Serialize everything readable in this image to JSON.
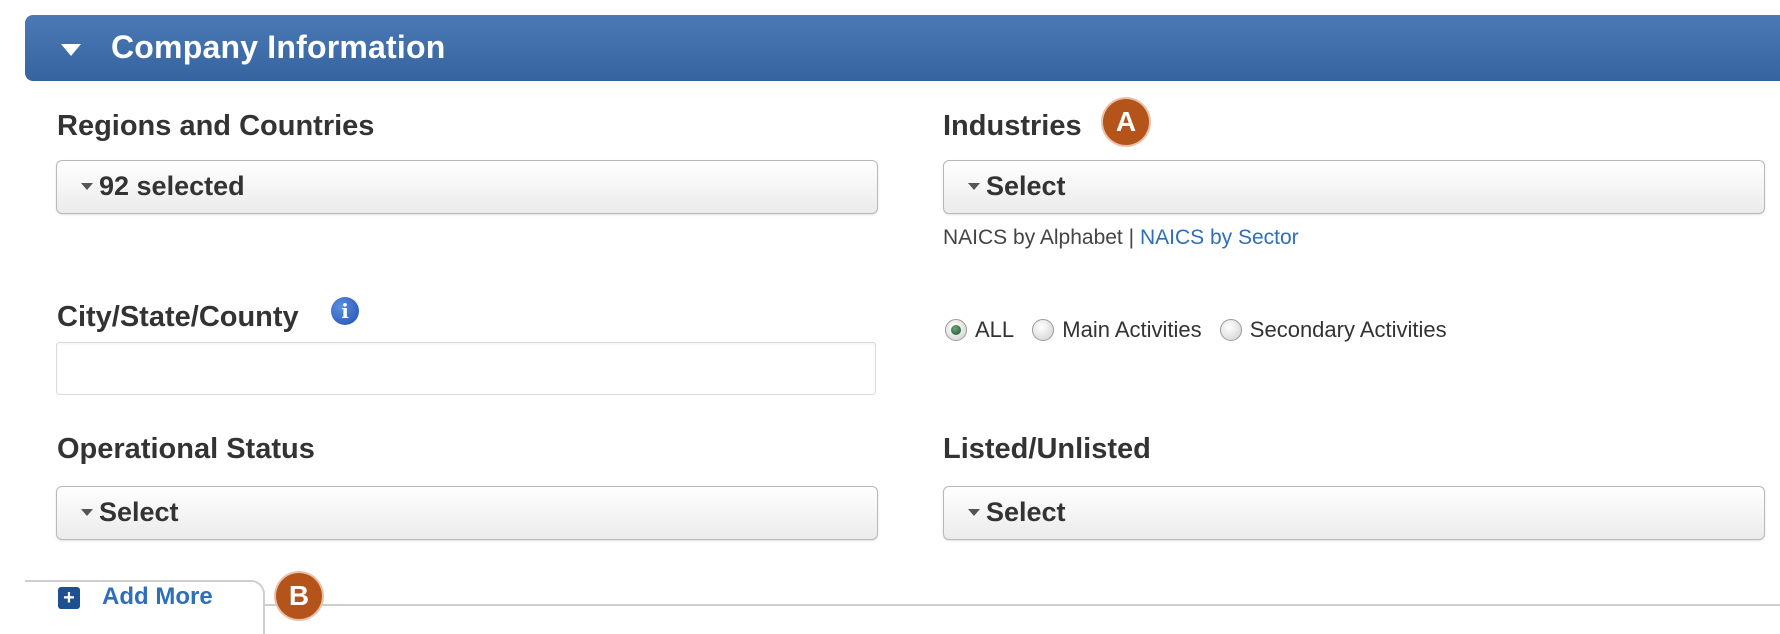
{
  "section": {
    "title": "Company Information"
  },
  "regions": {
    "label": "Regions and Countries",
    "value": "92 selected"
  },
  "industries": {
    "label": "Industries",
    "value": "Select",
    "badge": "A",
    "links": {
      "alphabet": "NAICS by Alphabet",
      "separator": "|",
      "sector": "NAICS by Sector"
    },
    "radios": [
      {
        "label": "ALL",
        "checked": true
      },
      {
        "label": "Main Activities",
        "checked": false
      },
      {
        "label": "Secondary Activities",
        "checked": false
      }
    ]
  },
  "city": {
    "label": "City/State/County",
    "value": "",
    "info_icon": "info-icon"
  },
  "operational": {
    "label": "Operational Status",
    "value": "Select"
  },
  "listed": {
    "label": "Listed/Unlisted",
    "value": "Select"
  },
  "add_more": {
    "label": "Add More",
    "badge": "B"
  },
  "colors": {
    "header": "#3a6aa8",
    "badge": "#b4541a",
    "link": "#2e6fb7"
  }
}
